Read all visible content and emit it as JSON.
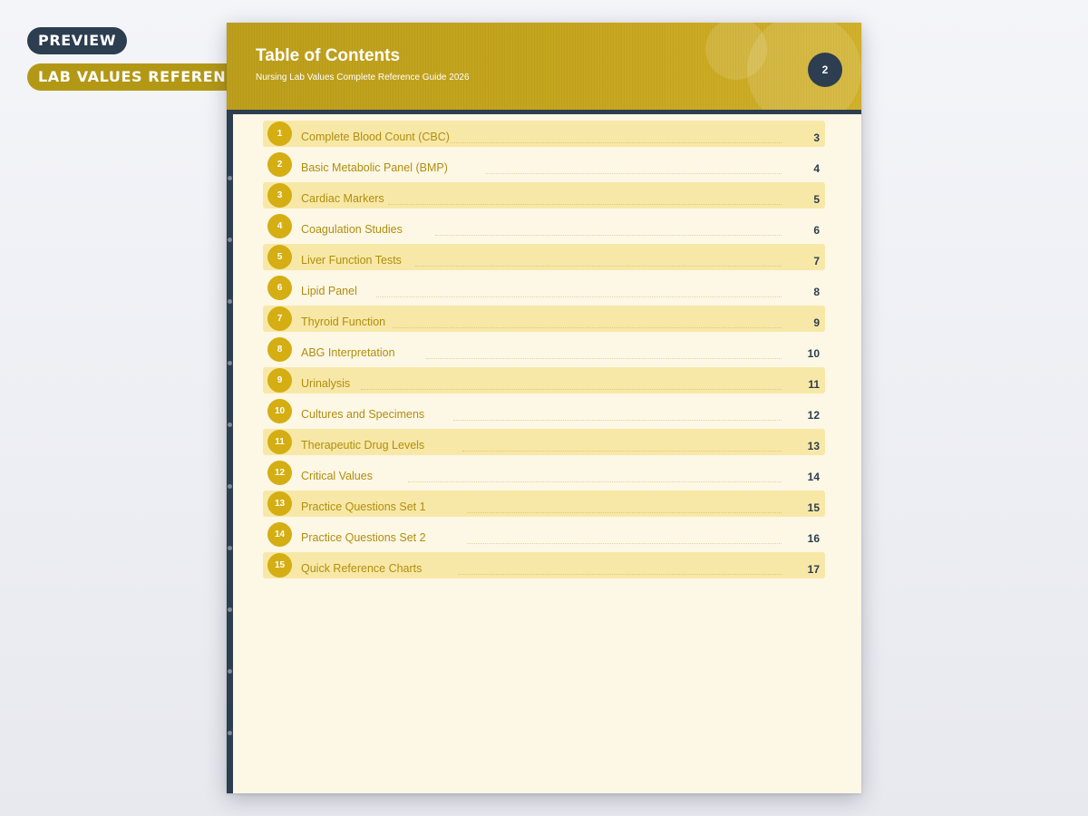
{
  "tags": {
    "preview": "PREVIEW",
    "category": "LAB VALUES REFERENCE"
  },
  "page": {
    "title": "Table of Contents",
    "subtitle": "Nursing Lab Values Complete Reference Guide 2026",
    "page_number": "2"
  },
  "toc": {
    "items": [
      {
        "num": "1",
        "label": "Complete Blood Count (CBC)",
        "page": "3"
      },
      {
        "num": "2",
        "label": "Basic Metabolic Panel (BMP)",
        "page": "4"
      },
      {
        "num": "3",
        "label": "Cardiac Markers",
        "page": "5"
      },
      {
        "num": "4",
        "label": "Coagulation Studies",
        "page": "6"
      },
      {
        "num": "5",
        "label": "Liver Function Tests",
        "page": "7"
      },
      {
        "num": "6",
        "label": "Lipid Panel",
        "page": "8"
      },
      {
        "num": "7",
        "label": "Thyroid Function",
        "page": "9"
      },
      {
        "num": "8",
        "label": "ABG Interpretation",
        "page": "10"
      },
      {
        "num": "9",
        "label": "Urinalysis",
        "page": "11"
      },
      {
        "num": "10",
        "label": "Cultures and Specimens",
        "page": "12"
      },
      {
        "num": "11",
        "label": "Therapeutic Drug Levels",
        "page": "13"
      },
      {
        "num": "12",
        "label": "Critical Values",
        "page": "14"
      },
      {
        "num": "13",
        "label": "Practice Questions Set 1",
        "page": "15"
      },
      {
        "num": "14",
        "label": "Practice Questions Set 2",
        "page": "16"
      },
      {
        "num": "15",
        "label": "Quick Reference Charts",
        "page": "17"
      }
    ]
  },
  "colors": {
    "header_gold": "#c6a61e",
    "accent_navy": "#2c3e50",
    "number_circle": "#d4ae12",
    "row_shade": "#f8e8a7",
    "page_background": "#fdf7e5"
  }
}
